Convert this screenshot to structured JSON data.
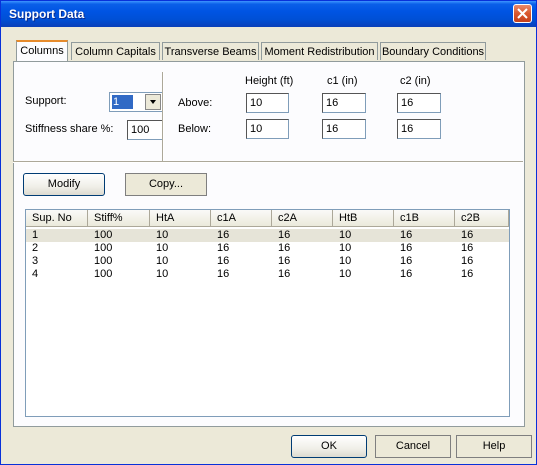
{
  "window": {
    "title": "Support Data"
  },
  "tabs": [
    {
      "label": "Columns",
      "active": true
    },
    {
      "label": "Column Capitals",
      "active": false
    },
    {
      "label": "Transverse Beams",
      "active": false
    },
    {
      "label": "Moment Redistribution",
      "active": false
    },
    {
      "label": "Boundary Conditions",
      "active": false
    }
  ],
  "support": {
    "label": "Support:",
    "selected": "1",
    "stiffness_label": "Stiffness share %:",
    "stiffness_value": "100"
  },
  "dims": {
    "height_header": "Height (ft)",
    "c1_header": "c1 (in)",
    "c2_header": "c2 (in)",
    "above_label": "Above:",
    "below_label": "Below:",
    "above": {
      "height": "10",
      "c1": "16",
      "c2": "16"
    },
    "below": {
      "height": "10",
      "c1": "16",
      "c2": "16"
    }
  },
  "buttons": {
    "modify": "Modify",
    "copy": "Copy...",
    "ok": "OK",
    "cancel": "Cancel",
    "help": "Help"
  },
  "table": {
    "columns": [
      "Sup. No",
      "Stiff%",
      "HtA",
      "c1A",
      "c2A",
      "HtB",
      "c1B",
      "c2B"
    ],
    "rows": [
      [
        "1",
        "100",
        "10",
        "16",
        "16",
        "10",
        "16",
        "16"
      ],
      [
        "2",
        "100",
        "10",
        "16",
        "16",
        "10",
        "16",
        "16"
      ],
      [
        "3",
        "100",
        "10",
        "16",
        "16",
        "10",
        "16",
        "16"
      ],
      [
        "4",
        "100",
        "10",
        "16",
        "16",
        "10",
        "16",
        "16"
      ]
    ],
    "selected_row": 0
  },
  "colors": {
    "title_bar": "#0054e3",
    "close_button": "#d9582e",
    "selection": "#316ac5",
    "dialog_bg": "#ece9d8"
  }
}
